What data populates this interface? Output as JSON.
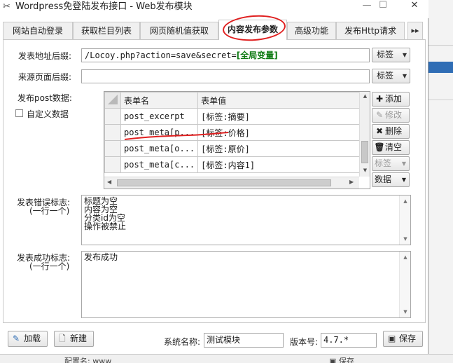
{
  "window": {
    "title": "Wordpress免登陆发布接口 - Web发布模块",
    "minimize": "—",
    "maximize": "☐",
    "close": "✕"
  },
  "tabs": [
    {
      "label": "网站自动登录",
      "active": false
    },
    {
      "label": "获取栏目列表",
      "active": false
    },
    {
      "label": "网页随机值获取",
      "active": false
    },
    {
      "label": "内容发布参数",
      "active": true
    },
    {
      "label": "高级功能",
      "active": false
    },
    {
      "label": "发布Http请求",
      "active": false
    }
  ],
  "tab_more": "▸▸",
  "form": {
    "post_url_suffix_label": "发表地址后缀:",
    "post_url_suffix_value": "/Locoy.php?action=save&secret=",
    "post_url_suffix_tag": "[全局变量]",
    "source_page_suffix_label": "来源页面后缀:",
    "source_page_suffix_value": "",
    "tag_button": "标签",
    "post_data_label": "发布post数据:",
    "custom_data_label": "自定义数据"
  },
  "grid": {
    "headers": [
      "表单名",
      "表单值"
    ],
    "rows": [
      {
        "name": "post_excerpt",
        "value": "[标签:摘要]"
      },
      {
        "name": "post_meta[p...",
        "value": "[标签:价格]"
      },
      {
        "name": "post_meta[o...",
        "value": "[标签:原价]"
      },
      {
        "name": "post_meta[c...",
        "value": "[标签:内容1]"
      }
    ]
  },
  "side_buttons": {
    "add": "添加",
    "edit": "修改",
    "delete": "删除",
    "clear": "清空",
    "tag": "标签",
    "data": "数据"
  },
  "error_flag": {
    "label_line1": "发表错误标志:",
    "label_line2": "(一行一个)",
    "lines": [
      "标题为空",
      "内容为空",
      "分类id为空",
      "操作被禁止"
    ]
  },
  "success_flag": {
    "label_line1": "发表成功标志:",
    "label_line2": "(一行一个)",
    "lines": [
      "发布成功"
    ]
  },
  "bottom": {
    "load_button": "加载",
    "new_button": "新建",
    "system_name_label": "系统名称:",
    "system_name_value": "测试模块",
    "version_label": "版本号:",
    "version_value": "4.7.*",
    "save_button": "保存"
  },
  "background": {
    "config_label": "配置名:",
    "config_value": "www",
    "save_button": "保存"
  },
  "colors": {
    "annotation_red": "#e02020",
    "tag_green": "#0e7a12"
  }
}
